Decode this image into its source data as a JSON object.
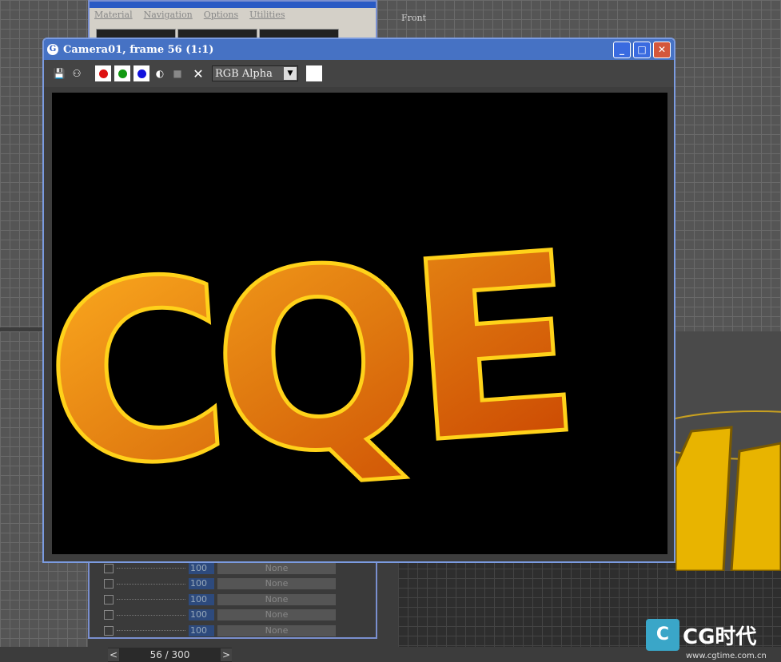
{
  "material_editor": {
    "menu": [
      "Material",
      "Navigation",
      "Options",
      "Utilities"
    ],
    "rows": [
      {
        "amount": "100",
        "map": "None"
      },
      {
        "amount": "100",
        "map": "None"
      },
      {
        "amount": "100",
        "map": "None"
      },
      {
        "amount": "100",
        "map": "None"
      },
      {
        "amount": "100",
        "map": "None"
      }
    ]
  },
  "viewport": {
    "front_label": "Front"
  },
  "render_window": {
    "title": "Camera01, frame 56 (1:1)",
    "channel_select": "RGB Alpha",
    "channels": [
      "red-channel",
      "green-channel",
      "blue-channel"
    ],
    "channel_colors": {
      "red": "#dd1111",
      "green": "#119911",
      "blue": "#1111dd"
    },
    "render_text": "CQE"
  },
  "timeline": {
    "frame_label": "56 / 300"
  },
  "watermark": {
    "logo_letter": "C",
    "brand": "CG时代",
    "url": "www.cgtime.com.cn"
  }
}
